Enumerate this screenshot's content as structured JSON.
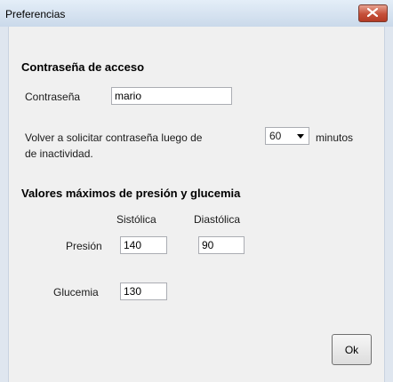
{
  "window": {
    "title": "Preferencias"
  },
  "password_section": {
    "heading": "Contraseña de acceso",
    "password_label": "Contraseña",
    "password_value": "mario",
    "relogin_prefix": "Volver a solicitar contraseña luego de",
    "minutes_selected": "60",
    "relogin_suffix_1": "minutos",
    "relogin_suffix_2": "de inactividad."
  },
  "limits_section": {
    "heading": "Valores máximos de presión y glucemia",
    "systolic_header": "Sistólica",
    "diastolic_header": "Diastólica",
    "pressure_label": "Presión",
    "systolic_value": "140",
    "diastolic_value": "90",
    "glucose_label": "Glucemia",
    "glucose_value": "130"
  },
  "buttons": {
    "ok_label": "Ok"
  },
  "colors": {
    "close_button": "#c5503a",
    "window_background": "#f0f0f0"
  }
}
